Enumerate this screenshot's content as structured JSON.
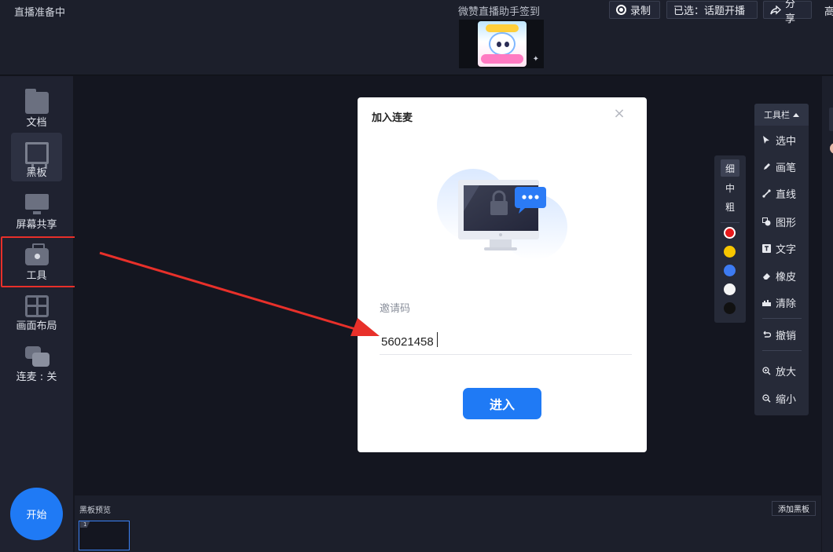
{
  "topbar": {
    "status": "直播准备中",
    "room_title": "微赞直播助手签到",
    "thumb_watermark": "✦",
    "record_label": "录制",
    "selected_label": "已选：话题开播",
    "share_label": "分享",
    "hd_label": "高"
  },
  "sidebar": {
    "items": [
      {
        "label": "文档",
        "icon": "folder-icon"
      },
      {
        "label": "黑板",
        "icon": "blackboard-icon"
      },
      {
        "label": "屏幕共享",
        "icon": "monitor-icon"
      },
      {
        "label": "工具",
        "icon": "toolbox-icon"
      },
      {
        "label": "画面布局",
        "icon": "layout-icon"
      },
      {
        "label": "连麦 : 关",
        "icon": "chat-icon"
      }
    ],
    "start_label": "开始"
  },
  "preview": {
    "label": "黑板预览",
    "thumb_number": "1",
    "add_label": "添加黑板"
  },
  "pen_panel": {
    "sizes": [
      "细",
      "中",
      "粗"
    ],
    "selected_size": "细",
    "colors": [
      "#e8191b",
      "#f7c600",
      "#3d7bf2",
      "#f5f5f5",
      "#111111"
    ]
  },
  "toolbar": {
    "header": "工具栏",
    "tools": [
      {
        "label": "选中",
        "icon": "cursor-icon"
      },
      {
        "label": "画笔",
        "icon": "pen-icon"
      },
      {
        "label": "直线",
        "icon": "line-icon"
      },
      {
        "label": "图形",
        "icon": "shape-icon"
      },
      {
        "label": "文字",
        "icon": "text-icon"
      },
      {
        "label": "橡皮",
        "icon": "eraser-icon"
      },
      {
        "label": "清除",
        "icon": "clear-icon"
      },
      {
        "label": "撤销",
        "icon": "undo-icon"
      },
      {
        "label": "放大",
        "icon": "zoom-in-icon"
      },
      {
        "label": "缩小",
        "icon": "zoom-out-icon"
      }
    ]
  },
  "modal": {
    "title": "加入连麦",
    "close": "×",
    "invite_label": "邀请码",
    "invite_value": "56021458",
    "enter_label": "进入"
  },
  "colors": {
    "accent": "#1f7af5",
    "highlight_red": "#e8302a",
    "background": "#14161f"
  }
}
